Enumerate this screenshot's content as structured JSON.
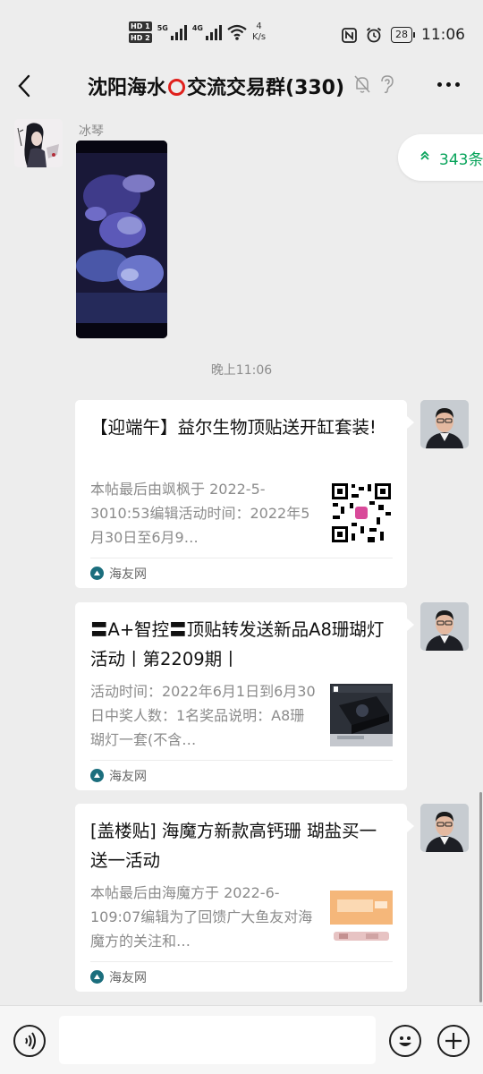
{
  "status_bar": {
    "hd1": "HD 1",
    "hd2": "HD 2",
    "net1": "5G",
    "net2": "4G",
    "speed_value": "4",
    "speed_unit": "K/s",
    "battery": "28",
    "time": "11:06"
  },
  "header": {
    "title_before": "沈阳海水",
    "title_after": "交流交易群(330)"
  },
  "chat": {
    "sender_name": "冰琴",
    "unread_label": "343条",
    "timestamp": "晚上11:06",
    "cards": [
      {
        "title": "【迎端午】益尔生物顶贴送开缸套装!",
        "desc": "本帖最后由飒枫于 2022-5-3010:53编辑活动时间：2022年5月30日至6月9…",
        "source": "海友网"
      },
      {
        "title": "〓A+智控〓顶贴转发送新品A8珊瑚灯活动丨第2209期丨",
        "desc": "活动时间：2022年6月1日到6月30日中奖人数：1名奖品说明：A8珊瑚灯一套(不含…",
        "source": "海友网"
      },
      {
        "title": "[盖楼贴] 海魔方新款高钙珊 瑚盐买一送一活动",
        "desc": "本帖最后由海魔方于 2022-6-109:07编辑为了回馈广大鱼友对海魔方的关注和…",
        "source": "海友网"
      }
    ]
  },
  "input_bar": {
    "message_value": ""
  },
  "colors": {
    "accent_green": "#07a35a",
    "background": "#ededed",
    "red_ring": "#e0201c"
  },
  "icons": [
    "back-arrow-icon",
    "mute-bell-icon",
    "ear-icon",
    "more-icon",
    "voice-icon",
    "emoji-icon",
    "plus-icon",
    "double-chevron-up-icon",
    "source-logo-icon"
  ]
}
